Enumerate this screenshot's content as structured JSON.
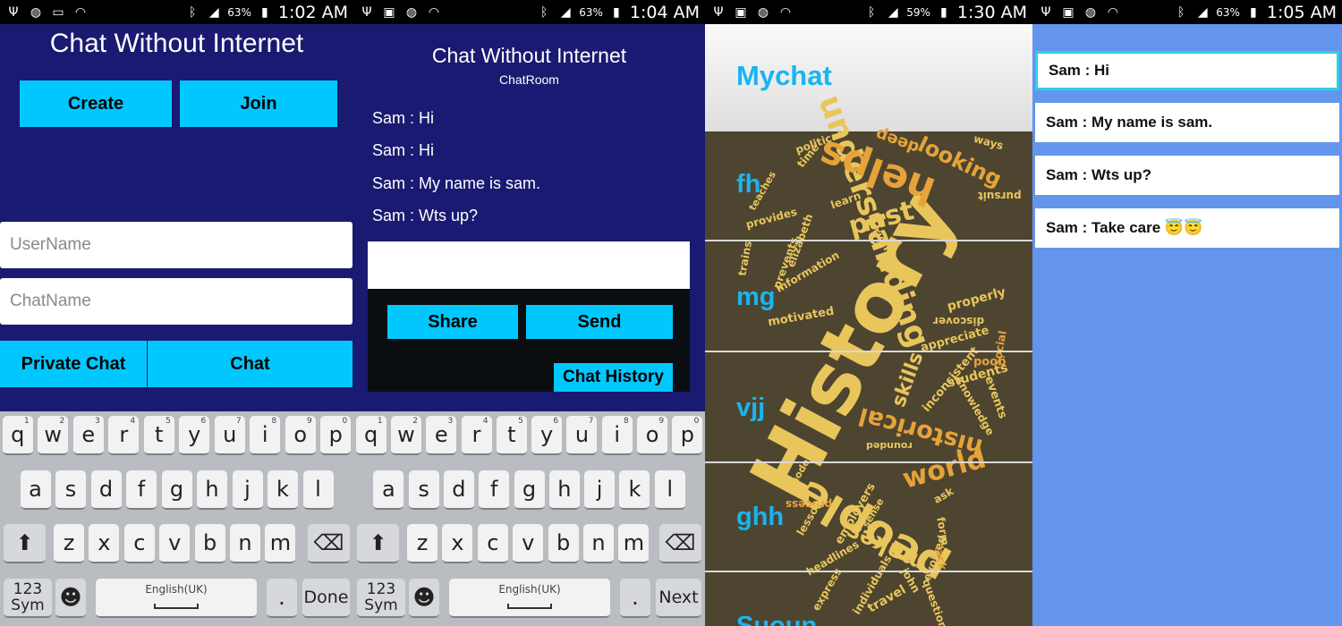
{
  "screens": [
    {
      "status": {
        "battery": "63%",
        "time": "1:02 AM"
      },
      "title": "Chat Without Internet",
      "create_label": "Create",
      "join_label": "Join",
      "username_placeholder": "UserName",
      "chatname_placeholder": "ChatName",
      "private_chat_label": "Private Chat",
      "chat_label": "Chat",
      "keyboard": {
        "enter_label": "Done"
      }
    },
    {
      "status": {
        "battery": "63%",
        "time": "1:04 AM"
      },
      "title": "Chat Without Internet",
      "subtitle": "ChatRoom",
      "messages": [
        "Sam : Hi",
        "Sam : Hi",
        "Sam : My name is sam.",
        "Sam : Wts up?"
      ],
      "share_label": "Share",
      "send_label": "Send",
      "history_label": "Chat History",
      "keyboard": {
        "enter_label": "Next"
      }
    },
    {
      "status": {
        "battery": "59%",
        "time": "1:30 AM"
      },
      "title": "Mychat",
      "items": [
        "fh",
        "mg",
        "vjj",
        "ghh",
        "Suoun"
      ]
    },
    {
      "status": {
        "battery": "63%",
        "time": "1:05 AM"
      },
      "messages": [
        "Sam : Hi",
        "Sam : My name is sam.",
        "Sam : Wts up?",
        "Sam : Take care 😇😇"
      ]
    }
  ],
  "keyboard": {
    "row1": [
      [
        "q",
        "1"
      ],
      [
        "w",
        "2"
      ],
      [
        "e",
        "3"
      ],
      [
        "r",
        "4"
      ],
      [
        "t",
        "5"
      ],
      [
        "y",
        "6"
      ],
      [
        "u",
        "7"
      ],
      [
        "i",
        "8"
      ],
      [
        "o",
        "9"
      ],
      [
        "p",
        "0"
      ]
    ],
    "row2": [
      "a",
      "s",
      "d",
      "f",
      "g",
      "h",
      "j",
      "k",
      "l"
    ],
    "row3": [
      "z",
      "x",
      "c",
      "v",
      "b",
      "n",
      "m"
    ],
    "sym_label": "123",
    "sym_sub": "Sym",
    "language": "English(UK)",
    "period": "."
  },
  "wordcloud": [
    "History",
    "people",
    "understanding",
    "helps",
    "past",
    "historical",
    "world",
    "looking",
    "makes",
    "skills",
    "students",
    "inconsistent",
    "appreciate",
    "motivated",
    "information",
    "properly",
    "discover",
    "good",
    "events",
    "knowledge",
    "rounded",
    "modern",
    "employers",
    "process",
    "sense",
    "headlines",
    "lesson",
    "express",
    "individuals",
    "travel",
    "john",
    "evolved",
    "form",
    "lack",
    "trains",
    "provides",
    "teaches",
    "political",
    "time",
    "ways",
    "pursuit",
    "learn",
    "origins",
    "elizabeth",
    "prevents",
    "social",
    "ask",
    "questions",
    "deep"
  ],
  "colors": {
    "accent": "#00c8ff",
    "navy": "#1a1a72",
    "cloud_bg": "#4e4530",
    "list_blue": "#19b5f0",
    "chat_bg": "#6495ed"
  }
}
